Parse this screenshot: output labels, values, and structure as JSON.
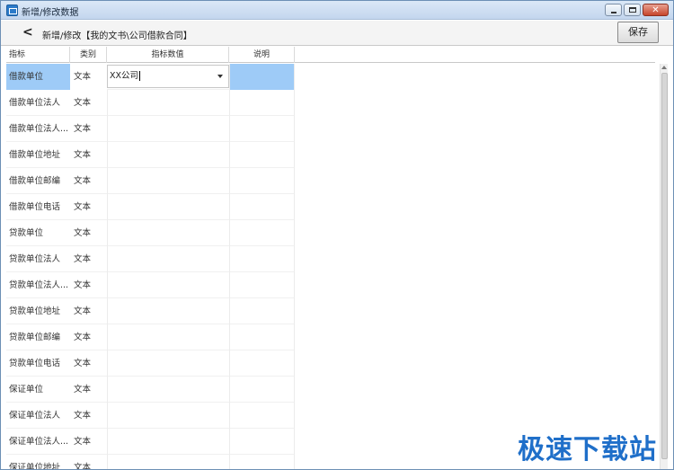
{
  "window": {
    "title": "新增/修改数据",
    "minimize_glyph": "–",
    "maximize_glyph": "□",
    "close_glyph": "✕"
  },
  "header": {
    "back_glyph": "<",
    "title": "新增/修改【我的文书\\公司借款合同】",
    "save_label": "保存"
  },
  "table": {
    "columns": [
      "指标",
      "类别",
      "指标数值",
      "说明"
    ],
    "rows": [
      {
        "name": "借款单位",
        "type": "文本",
        "value": "XX公司",
        "note": "",
        "selected": true
      },
      {
        "name": "借款单位法人",
        "type": "文本",
        "value": "",
        "note": ""
      },
      {
        "name": "借款单位法人...",
        "type": "文本",
        "value": "",
        "note": ""
      },
      {
        "name": "借款单位地址",
        "type": "文本",
        "value": "",
        "note": ""
      },
      {
        "name": "借款单位邮编",
        "type": "文本",
        "value": "",
        "note": ""
      },
      {
        "name": "借款单位电话",
        "type": "文本",
        "value": "",
        "note": ""
      },
      {
        "name": "贷款单位",
        "type": "文本",
        "value": "",
        "note": ""
      },
      {
        "name": "贷款单位法人",
        "type": "文本",
        "value": "",
        "note": ""
      },
      {
        "name": "贷款单位法人...",
        "type": "文本",
        "value": "",
        "note": ""
      },
      {
        "name": "贷款单位地址",
        "type": "文本",
        "value": "",
        "note": ""
      },
      {
        "name": "贷款单位邮编",
        "type": "文本",
        "value": "",
        "note": ""
      },
      {
        "name": "贷款单位电话",
        "type": "文本",
        "value": "",
        "note": ""
      },
      {
        "name": "保证单位",
        "type": "文本",
        "value": "",
        "note": ""
      },
      {
        "name": "保证单位法人",
        "type": "文本",
        "value": "",
        "note": ""
      },
      {
        "name": "保证单位法人...",
        "type": "文本",
        "value": "",
        "note": ""
      },
      {
        "name": "保证单位地址",
        "type": "文本",
        "value": "",
        "note": ""
      }
    ]
  },
  "watermark": "极速下载站",
  "colors": {
    "selection": "#9ecbf7",
    "titlebar": "#c3d6ee",
    "watermark": "#1f6fc9"
  }
}
